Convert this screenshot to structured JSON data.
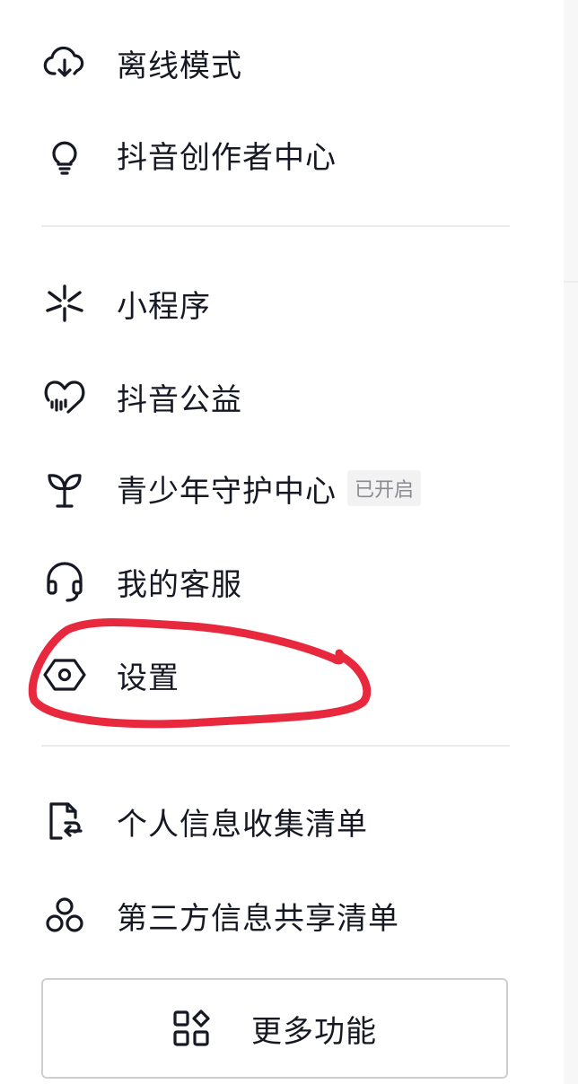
{
  "menu": {
    "group1": [
      {
        "label": "离线模式",
        "icon": "cloud-download-icon"
      },
      {
        "label": "抖音创作者中心",
        "icon": "lightbulb-icon"
      }
    ],
    "group2": [
      {
        "label": "小程序",
        "icon": "mini-program-icon"
      },
      {
        "label": "抖音公益",
        "icon": "charity-heart-icon"
      },
      {
        "label": "青少年守护中心",
        "icon": "sprout-icon",
        "badge": "已开启"
      },
      {
        "label": "我的客服",
        "icon": "headset-icon"
      },
      {
        "label": "设置",
        "icon": "settings-hexagon-icon"
      }
    ],
    "group3": [
      {
        "label": "个人信息收集清单",
        "icon": "document-return-icon"
      },
      {
        "label": "第三方信息共享清单",
        "icon": "share-circles-icon"
      }
    ]
  },
  "more_button": {
    "label": "更多功能",
    "icon": "apps-grid-icon"
  },
  "colors": {
    "text": "#161823",
    "divider": "#ebebeb",
    "badge_bg": "#f2f2f3",
    "badge_text": "#8a8b91",
    "highlight_stroke": "#e8283c"
  }
}
